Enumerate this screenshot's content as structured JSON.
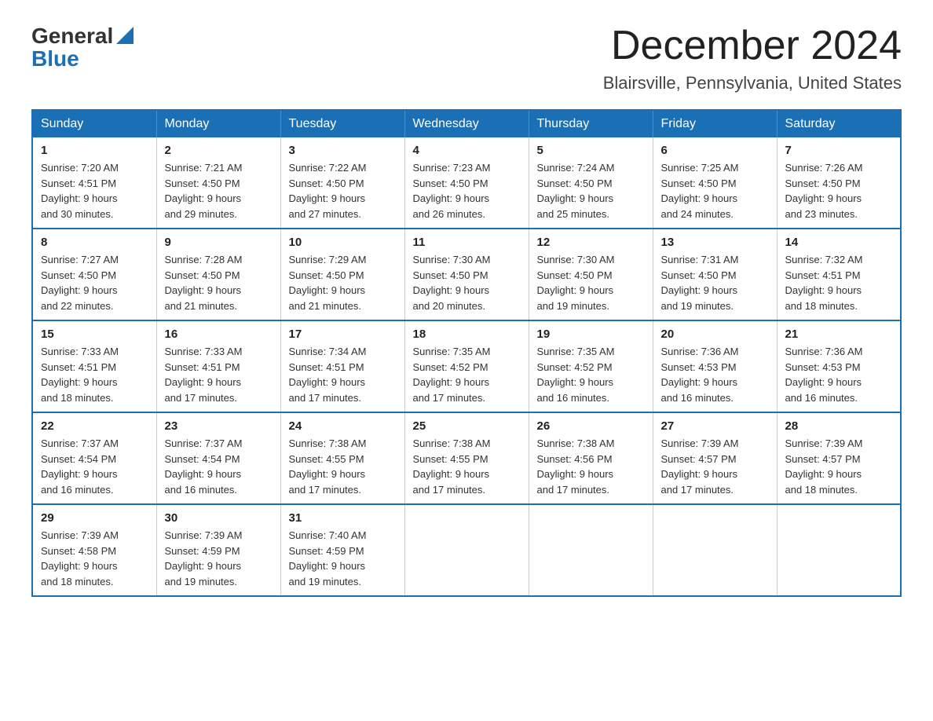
{
  "logo": {
    "general": "General",
    "blue": "Blue"
  },
  "header": {
    "month": "December 2024",
    "location": "Blairsville, Pennsylvania, United States"
  },
  "days_of_week": [
    "Sunday",
    "Monday",
    "Tuesday",
    "Wednesday",
    "Thursday",
    "Friday",
    "Saturday"
  ],
  "weeks": [
    [
      {
        "day": 1,
        "sunrise": "7:20 AM",
        "sunset": "4:51 PM",
        "daylight": "9 hours and 30 minutes."
      },
      {
        "day": 2,
        "sunrise": "7:21 AM",
        "sunset": "4:50 PM",
        "daylight": "9 hours and 29 minutes."
      },
      {
        "day": 3,
        "sunrise": "7:22 AM",
        "sunset": "4:50 PM",
        "daylight": "9 hours and 27 minutes."
      },
      {
        "day": 4,
        "sunrise": "7:23 AM",
        "sunset": "4:50 PM",
        "daylight": "9 hours and 26 minutes."
      },
      {
        "day": 5,
        "sunrise": "7:24 AM",
        "sunset": "4:50 PM",
        "daylight": "9 hours and 25 minutes."
      },
      {
        "day": 6,
        "sunrise": "7:25 AM",
        "sunset": "4:50 PM",
        "daylight": "9 hours and 24 minutes."
      },
      {
        "day": 7,
        "sunrise": "7:26 AM",
        "sunset": "4:50 PM",
        "daylight": "9 hours and 23 minutes."
      }
    ],
    [
      {
        "day": 8,
        "sunrise": "7:27 AM",
        "sunset": "4:50 PM",
        "daylight": "9 hours and 22 minutes."
      },
      {
        "day": 9,
        "sunrise": "7:28 AM",
        "sunset": "4:50 PM",
        "daylight": "9 hours and 21 minutes."
      },
      {
        "day": 10,
        "sunrise": "7:29 AM",
        "sunset": "4:50 PM",
        "daylight": "9 hours and 21 minutes."
      },
      {
        "day": 11,
        "sunrise": "7:30 AM",
        "sunset": "4:50 PM",
        "daylight": "9 hours and 20 minutes."
      },
      {
        "day": 12,
        "sunrise": "7:30 AM",
        "sunset": "4:50 PM",
        "daylight": "9 hours and 19 minutes."
      },
      {
        "day": 13,
        "sunrise": "7:31 AM",
        "sunset": "4:50 PM",
        "daylight": "9 hours and 19 minutes."
      },
      {
        "day": 14,
        "sunrise": "7:32 AM",
        "sunset": "4:51 PM",
        "daylight": "9 hours and 18 minutes."
      }
    ],
    [
      {
        "day": 15,
        "sunrise": "7:33 AM",
        "sunset": "4:51 PM",
        "daylight": "9 hours and 18 minutes."
      },
      {
        "day": 16,
        "sunrise": "7:33 AM",
        "sunset": "4:51 PM",
        "daylight": "9 hours and 17 minutes."
      },
      {
        "day": 17,
        "sunrise": "7:34 AM",
        "sunset": "4:51 PM",
        "daylight": "9 hours and 17 minutes."
      },
      {
        "day": 18,
        "sunrise": "7:35 AM",
        "sunset": "4:52 PM",
        "daylight": "9 hours and 17 minutes."
      },
      {
        "day": 19,
        "sunrise": "7:35 AM",
        "sunset": "4:52 PM",
        "daylight": "9 hours and 16 minutes."
      },
      {
        "day": 20,
        "sunrise": "7:36 AM",
        "sunset": "4:53 PM",
        "daylight": "9 hours and 16 minutes."
      },
      {
        "day": 21,
        "sunrise": "7:36 AM",
        "sunset": "4:53 PM",
        "daylight": "9 hours and 16 minutes."
      }
    ],
    [
      {
        "day": 22,
        "sunrise": "7:37 AM",
        "sunset": "4:54 PM",
        "daylight": "9 hours and 16 minutes."
      },
      {
        "day": 23,
        "sunrise": "7:37 AM",
        "sunset": "4:54 PM",
        "daylight": "9 hours and 16 minutes."
      },
      {
        "day": 24,
        "sunrise": "7:38 AM",
        "sunset": "4:55 PM",
        "daylight": "9 hours and 17 minutes."
      },
      {
        "day": 25,
        "sunrise": "7:38 AM",
        "sunset": "4:55 PM",
        "daylight": "9 hours and 17 minutes."
      },
      {
        "day": 26,
        "sunrise": "7:38 AM",
        "sunset": "4:56 PM",
        "daylight": "9 hours and 17 minutes."
      },
      {
        "day": 27,
        "sunrise": "7:39 AM",
        "sunset": "4:57 PM",
        "daylight": "9 hours and 17 minutes."
      },
      {
        "day": 28,
        "sunrise": "7:39 AM",
        "sunset": "4:57 PM",
        "daylight": "9 hours and 18 minutes."
      }
    ],
    [
      {
        "day": 29,
        "sunrise": "7:39 AM",
        "sunset": "4:58 PM",
        "daylight": "9 hours and 18 minutes."
      },
      {
        "day": 30,
        "sunrise": "7:39 AM",
        "sunset": "4:59 PM",
        "daylight": "9 hours and 19 minutes."
      },
      {
        "day": 31,
        "sunrise": "7:40 AM",
        "sunset": "4:59 PM",
        "daylight": "9 hours and 19 minutes."
      },
      null,
      null,
      null,
      null
    ]
  ],
  "cell_labels": {
    "sunrise": "Sunrise: ",
    "sunset": "Sunset: ",
    "daylight": "Daylight: "
  }
}
